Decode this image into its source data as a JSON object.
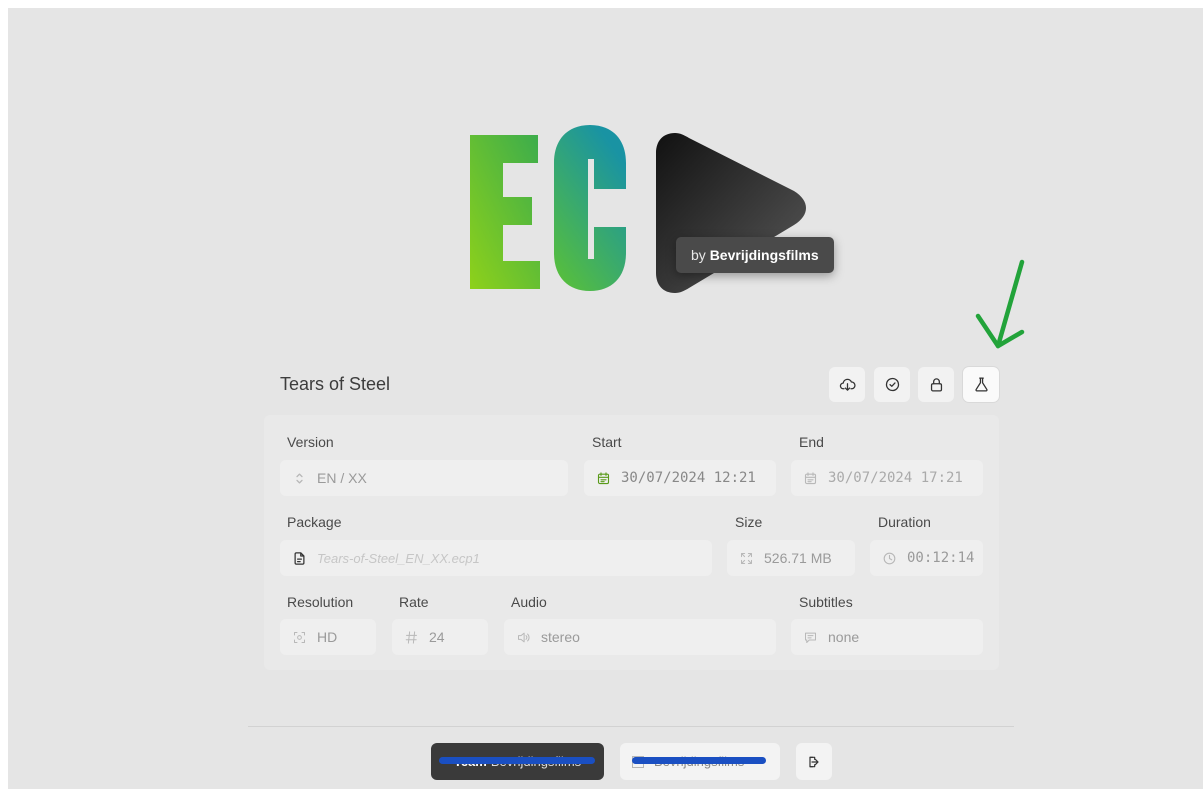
{
  "logo": {
    "letters": "EC",
    "byline_prefix": "by",
    "byline_brand": "Bevrijdingsfilms"
  },
  "title": "Tears of Steel",
  "toolbar": {
    "icons": [
      "cloud-download-icon",
      "check-circle-icon",
      "lock-icon",
      "flask-icon"
    ]
  },
  "fields": {
    "version": {
      "label": "Version",
      "value": "EN / XX"
    },
    "start": {
      "label": "Start",
      "value": "30/07/2024 12:21"
    },
    "end": {
      "label": "End",
      "value": "30/07/2024 17:21"
    },
    "package": {
      "label": "Package",
      "value": "Tears-of-Steel_EN_XX.ecp1"
    },
    "size": {
      "label": "Size",
      "value": "526.71 MB"
    },
    "duration": {
      "label": "Duration",
      "value": "00:12:14"
    },
    "resolution": {
      "label": "Resolution",
      "value": "HD"
    },
    "rate": {
      "label": "Rate",
      "value": "24"
    },
    "audio": {
      "label": "Audio",
      "value": "stereo"
    },
    "subtitles": {
      "label": "Subtitles",
      "value": "none"
    }
  },
  "footer": {
    "team_prefix": "Team",
    "team_name": "Bevrijdingsfilms",
    "org_name": "Bevrijdingsfilms"
  },
  "colors": {
    "background": "#e5e5e5",
    "accent_green": "#22a33a",
    "redaction": "#1a4fc2",
    "badge": "#4a4a4a"
  }
}
